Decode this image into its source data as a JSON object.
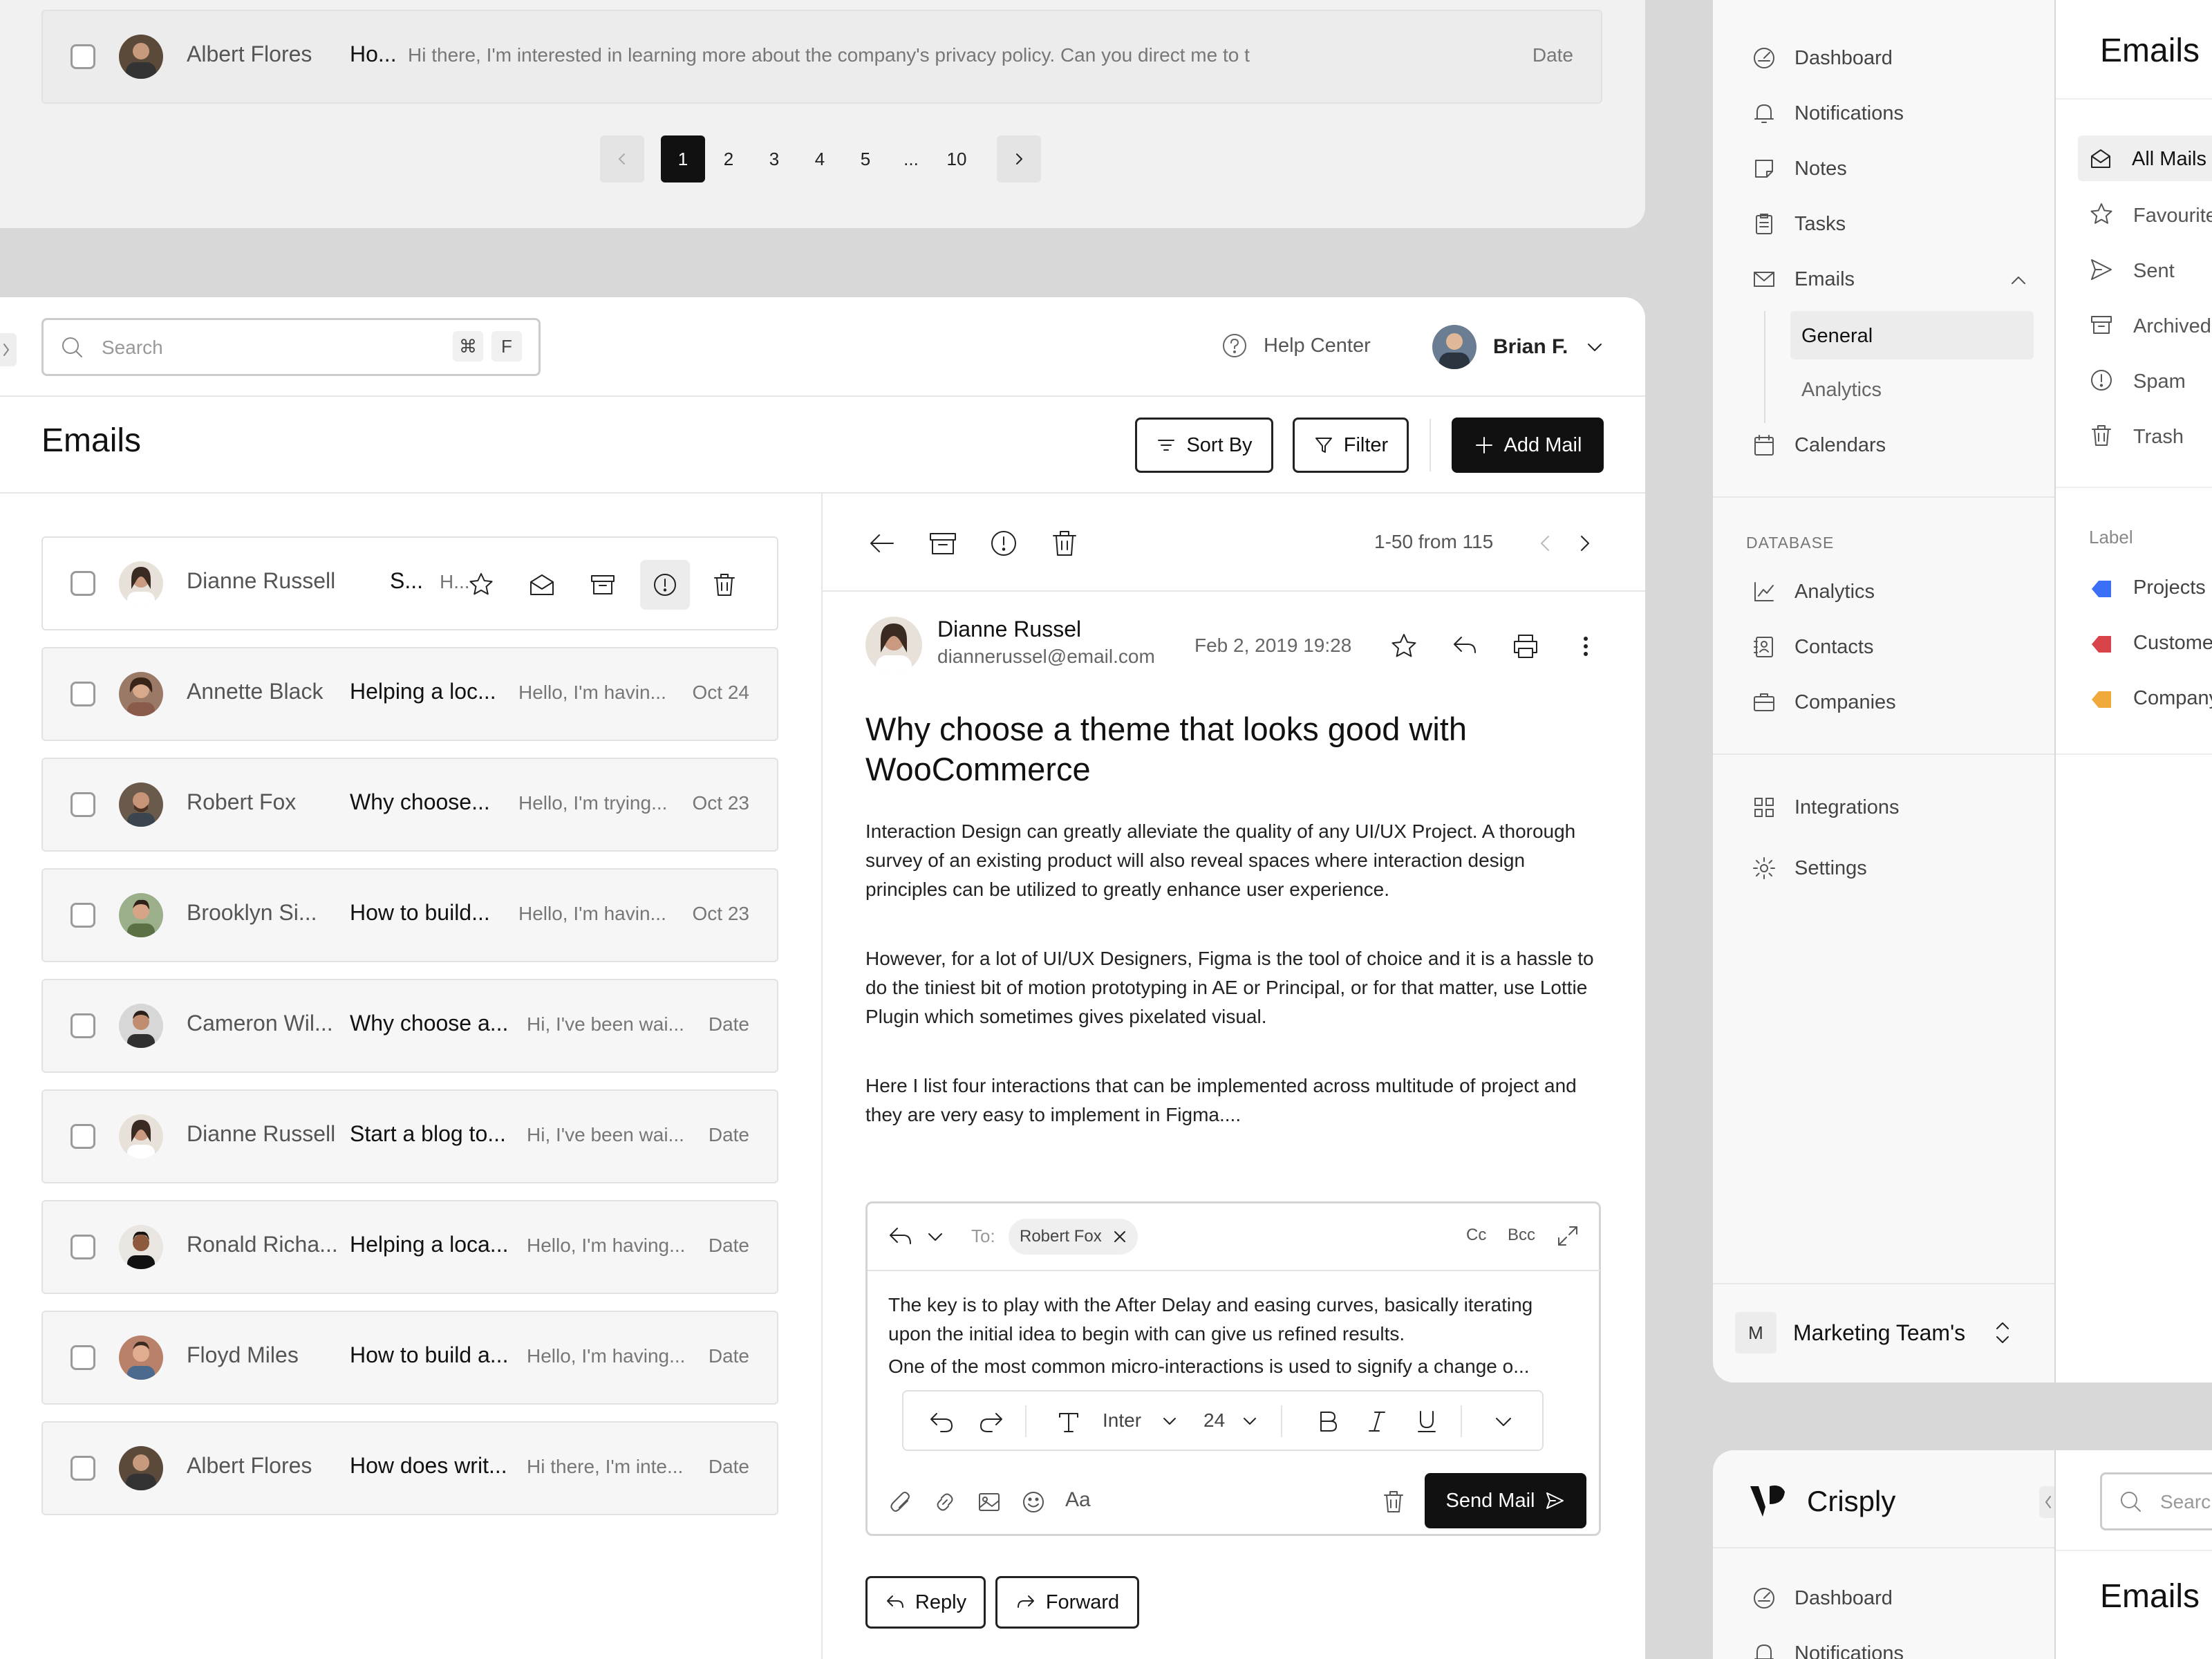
{
  "top_panel": {
    "row": {
      "name": "Albert Flores",
      "subject": "Ho...",
      "preview": "Hi there, I'm interested in learning more about the company's privacy policy. Can you direct me to t",
      "date": "Date"
    },
    "pagination": {
      "pages": [
        "1",
        "2",
        "3",
        "4",
        "5",
        "...",
        "10"
      ],
      "current": "1"
    }
  },
  "header": {
    "search_placeholder": "Search",
    "shortcut_cmd": "⌘",
    "shortcut_key": "F",
    "help_center": "Help Center",
    "user_name": "Brian F."
  },
  "page": {
    "title": "Emails",
    "sort_label": "Sort By",
    "filter_label": "Filter",
    "add_label": "Add Mail"
  },
  "email_list": [
    {
      "name": "Dianne Russell",
      "subject": "S...",
      "preview": "H...",
      "date": ""
    },
    {
      "name": "Annette Black",
      "subject": "Helping a loc...",
      "preview": "Hello, I'm havin...",
      "date": "Oct 24"
    },
    {
      "name": "Robert Fox",
      "subject": "Why choose...",
      "preview": "Hello, I'm trying...",
      "date": "Oct 23"
    },
    {
      "name": "Brooklyn Si...",
      "subject": "How to build...",
      "preview": "Hello, I'm havin...",
      "date": "Oct 23"
    },
    {
      "name": "Cameron Wil...",
      "subject": "Why choose a...",
      "preview": "Hi, I've been wai...",
      "date": "Date"
    },
    {
      "name": "Dianne Russell",
      "subject": "Start a blog to...",
      "preview": "Hi, I've been wai...",
      "date": "Date"
    },
    {
      "name": "Ronald Richa...",
      "subject": "Helping a loca...",
      "preview": "Hello, I'm having...",
      "date": "Date"
    },
    {
      "name": "Floyd Miles",
      "subject": "How to build a...",
      "preview": "Hello, I'm having...",
      "date": "Date"
    },
    {
      "name": "Albert Flores",
      "subject": "How does writ...",
      "preview": "Hi there, I'm inte...",
      "date": "Date"
    }
  ],
  "detail": {
    "range": "1-50 from 115",
    "sender_name": "Dianne Russel",
    "sender_email": "diannerussel@email.com",
    "date": "Feb 2, 2019 19:28",
    "subject": "Why choose a theme that looks good with WooCommerce",
    "paragraphs": [
      "Interaction Design can greatly alleviate the quality of any UI/UX Project. A thorough survey of an existing product will also reveal spaces where interaction design principles can be utilized to greatly enhance user experience.",
      "However, for a lot of UI/UX Designers, Figma is the tool of choice and it is a hassle to do the tiniest bit of motion prototyping in AE or Principal, or for that matter, use Lottie Plugin which sometimes gives pixelated visual.",
      "Here I list four interactions that can be implemented across multitude of project and they are very easy to implement in Figma...."
    ],
    "reply_box": {
      "to_label": "To:",
      "recipient": "Robert Fox",
      "cc": "Cc",
      "bcc": "Bcc",
      "text1": "The key is to play with the After Delay and easing curves, basically iterating upon the initial idea to begin with can give us refined results.",
      "text2": "One of the most common micro-interactions is used to signify a change o...",
      "font": "Inter",
      "size": "24",
      "send_label": "Send Mail"
    },
    "reply_label": "Reply",
    "forward_label": "Forward"
  },
  "sidebar": {
    "items": [
      {
        "label": "Dashboard",
        "icon": "dashboard-icon"
      },
      {
        "label": "Notifications",
        "icon": "bell-icon"
      },
      {
        "label": "Notes",
        "icon": "note-icon"
      },
      {
        "label": "Tasks",
        "icon": "clipboard-icon"
      },
      {
        "label": "Emails",
        "icon": "mail-icon"
      }
    ],
    "email_sub": [
      "General",
      "Analytics"
    ],
    "calendars": "Calendars",
    "db_heading": "DATABASE",
    "db_items": [
      "Analytics",
      "Contacts",
      "Companies"
    ],
    "integrations": "Integrations",
    "settings": "Settings",
    "team_initial": "M",
    "team_name": "Marketing Team's"
  },
  "mail_panel": {
    "title": "Emails",
    "folders": [
      "All Mails",
      "Favourite",
      "Sent",
      "Archived",
      "Spam",
      "Trash"
    ],
    "label_heading": "Label",
    "labels": [
      {
        "name": "Projects",
        "color": "#3b6ff5"
      },
      {
        "name": "Customer",
        "color": "#d9434a"
      },
      {
        "name": "Company",
        "color": "#f0a93b"
      }
    ]
  },
  "bottom": {
    "brand": "Crisply",
    "search_placeholder": "Search",
    "nav_dashboard": "Dashboard",
    "nav_notifications": "Notifications",
    "title": "Emails"
  },
  "colors": {
    "accent": "#111111",
    "page_bg": "#d8d8d8",
    "row_bg": "#f6f6f6"
  }
}
